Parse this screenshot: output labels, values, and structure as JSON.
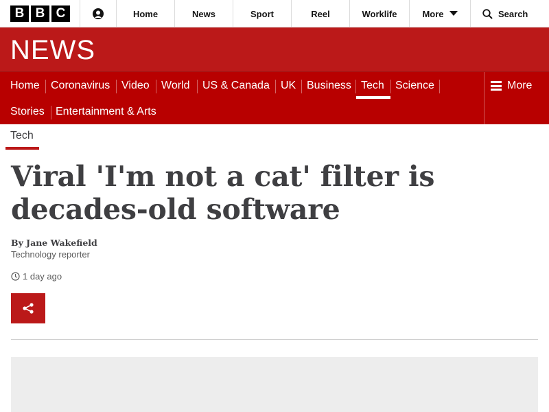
{
  "global_bar": {
    "logo_letters": [
      "B",
      "B",
      "C"
    ],
    "signin_icon": "account-icon",
    "nav": {
      "home": "Home",
      "news": "News",
      "sport": "Sport",
      "reel": "Reel",
      "worklife": "Worklife",
      "more": "More",
      "search": "Search"
    }
  },
  "header": {
    "title": "NEWS"
  },
  "section_nav": {
    "items": [
      "Home",
      "Coronavirus",
      "Video",
      "World",
      "US & Canada",
      "UK",
      "Business",
      "Tech",
      "Science",
      "Stories",
      "Entertainment & Arts"
    ],
    "active": "Tech",
    "more": "More"
  },
  "article": {
    "section": "Tech",
    "headline": "Viral 'I'm not a cat' filter is decades-old software",
    "byline_name": "By Jane Wakefield",
    "byline_role": "Technology reporter",
    "timestamp": "1 day ago"
  },
  "colors": {
    "brand_red": "#bb1919",
    "nav_red": "#b80000"
  }
}
